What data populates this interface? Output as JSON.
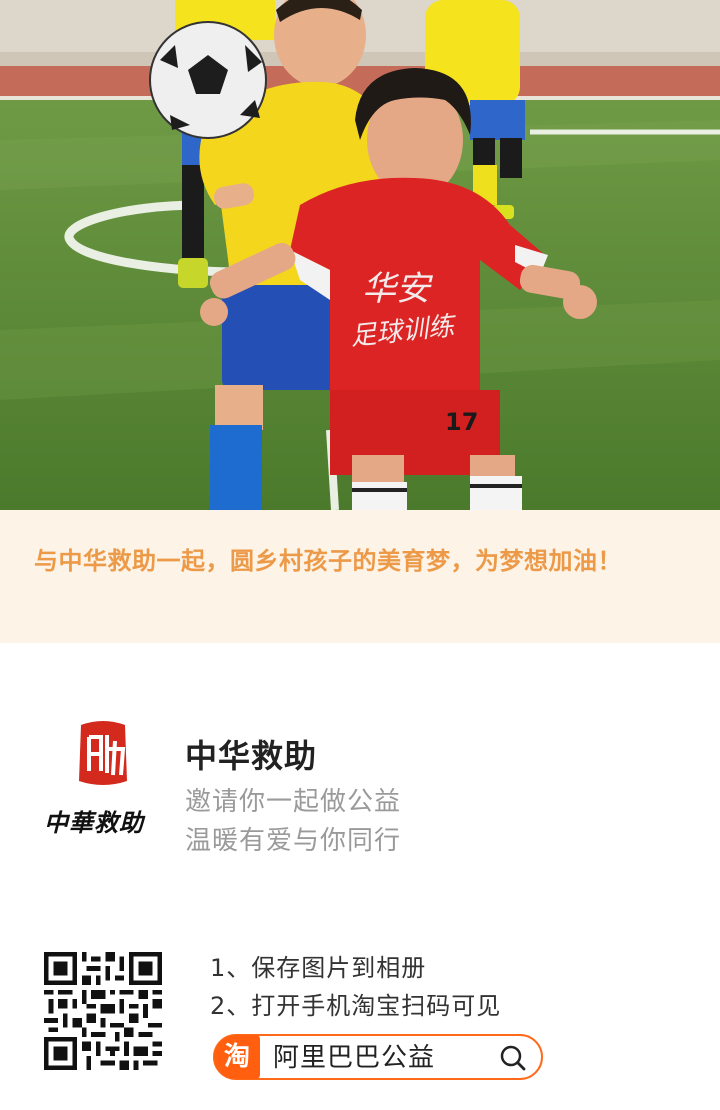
{
  "banner": {
    "slogan": "与中华救助一起，圆乡村孩子的美育梦，为梦想加油！"
  },
  "org": {
    "logo_text": "中華救助",
    "name": "中华救助",
    "line1": "邀请你一起做公益",
    "line2": "温暖有爱与你同行"
  },
  "steps": {
    "step1": "1、保存图片到相册",
    "step2": "2、打开手机淘宝扫码可见"
  },
  "search": {
    "badge": "淘",
    "text": "阿里巴巴公益"
  },
  "photo": {
    "jersey_text_1": "华安",
    "jersey_text_2": "足球训练",
    "jersey_number": "17"
  },
  "colors": {
    "banner_bg": "#fdf3e7",
    "banner_text": "#ec9a48",
    "brand_orange": "#ff5f0f",
    "seal_red": "#d42a1e"
  },
  "icons": {
    "qr": "qr-code-icon",
    "search": "magnifier-icon",
    "taobao": "taobao-icon"
  }
}
